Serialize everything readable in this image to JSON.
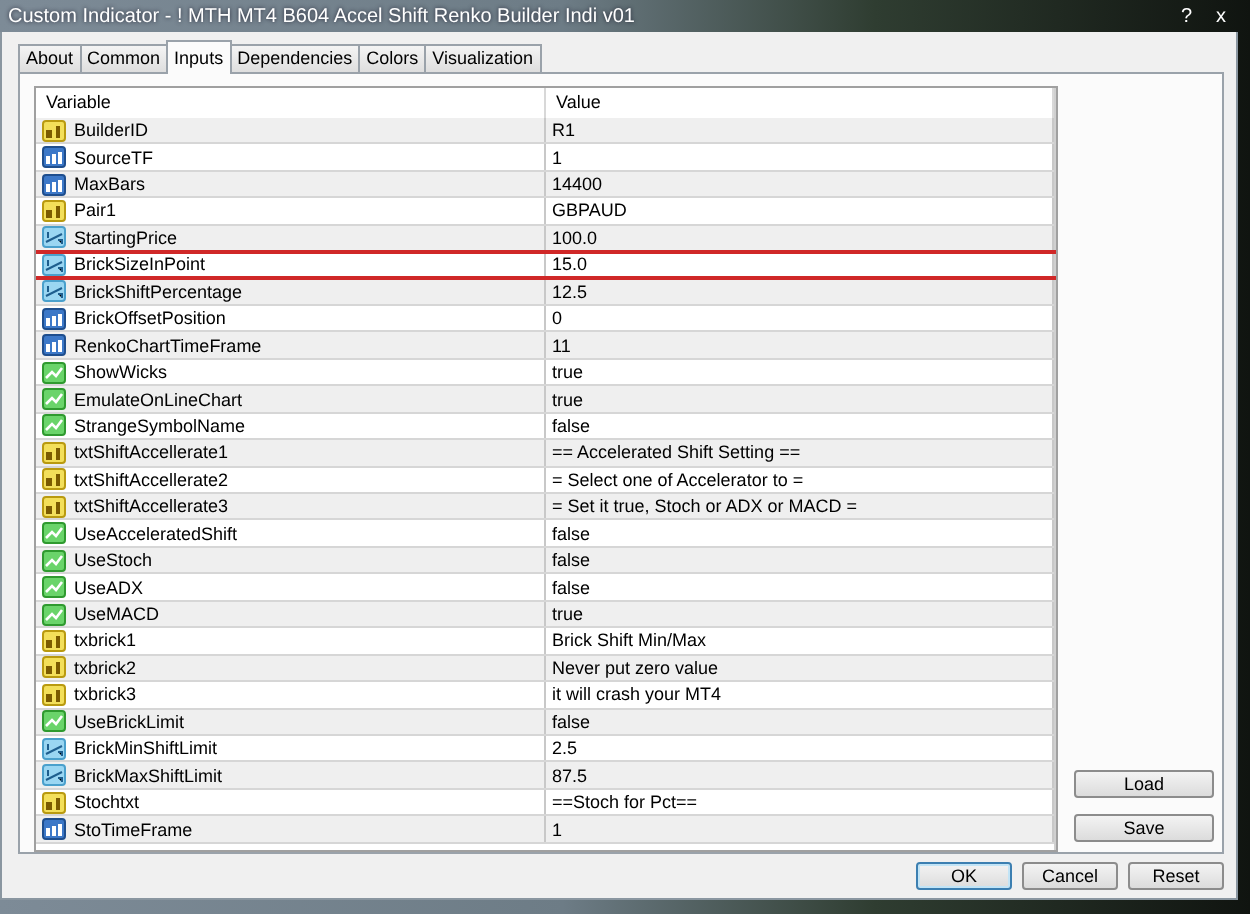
{
  "window": {
    "title": "Custom Indicator - !  MTH MT4 B604 Accel Shift Renko Builder Indi v01",
    "help": "?",
    "close": "x"
  },
  "tabs": [
    {
      "label": "About",
      "selected": false
    },
    {
      "label": "Common",
      "selected": false
    },
    {
      "label": "Inputs",
      "selected": true
    },
    {
      "label": "Dependencies",
      "selected": false
    },
    {
      "label": "Colors",
      "selected": false
    },
    {
      "label": "Visualization",
      "selected": false
    }
  ],
  "table": {
    "columns": [
      "Variable",
      "Value"
    ],
    "rows": [
      {
        "kind": "string",
        "variable": "BuilderID",
        "value": "R1",
        "highlighted": false
      },
      {
        "kind": "int",
        "variable": "SourceTF",
        "value": "1",
        "highlighted": false
      },
      {
        "kind": "int",
        "variable": "MaxBars",
        "value": "14400",
        "highlighted": false
      },
      {
        "kind": "string",
        "variable": "Pair1",
        "value": "GBPAUD",
        "highlighted": false
      },
      {
        "kind": "double",
        "variable": "StartingPrice",
        "value": "100.0",
        "highlighted": false
      },
      {
        "kind": "double",
        "variable": "BrickSizeInPoint",
        "value": "15.0",
        "highlighted": true
      },
      {
        "kind": "double",
        "variable": "BrickShiftPercentage",
        "value": "12.5",
        "highlighted": false
      },
      {
        "kind": "int",
        "variable": "BrickOffsetPosition",
        "value": "0",
        "highlighted": false
      },
      {
        "kind": "int",
        "variable": "RenkoChartTimeFrame",
        "value": "11",
        "highlighted": false
      },
      {
        "kind": "bool",
        "variable": "ShowWicks",
        "value": "true",
        "highlighted": false
      },
      {
        "kind": "bool",
        "variable": "EmulateOnLineChart",
        "value": "true",
        "highlighted": false
      },
      {
        "kind": "bool",
        "variable": "StrangeSymbolName",
        "value": "false",
        "highlighted": false
      },
      {
        "kind": "string",
        "variable": "txtShiftAccellerate1",
        "value": "== Accelerated Shift Setting  ==",
        "highlighted": false
      },
      {
        "kind": "string",
        "variable": "txtShiftAccellerate2",
        "value": "= Select one of Accelerator to =",
        "highlighted": false
      },
      {
        "kind": "string",
        "variable": "txtShiftAccellerate3",
        "value": "= Set it true, Stoch or ADX or MACD =",
        "highlighted": false
      },
      {
        "kind": "bool",
        "variable": "UseAcceleratedShift",
        "value": "false",
        "highlighted": false
      },
      {
        "kind": "bool",
        "variable": "UseStoch",
        "value": "false",
        "highlighted": false
      },
      {
        "kind": "bool",
        "variable": "UseADX",
        "value": "false",
        "highlighted": false
      },
      {
        "kind": "bool",
        "variable": "UseMACD",
        "value": "true",
        "highlighted": false
      },
      {
        "kind": "string",
        "variable": "txbrick1",
        "value": "Brick Shift Min/Max",
        "highlighted": false
      },
      {
        "kind": "string",
        "variable": "txbrick2",
        "value": "Never put zero value",
        "highlighted": false
      },
      {
        "kind": "string",
        "variable": "txbrick3",
        "value": "it will crash your MT4",
        "highlighted": false
      },
      {
        "kind": "bool",
        "variable": "UseBrickLimit",
        "value": "false",
        "highlighted": false
      },
      {
        "kind": "double",
        "variable": "BrickMinShiftLimit",
        "value": "2.5",
        "highlighted": false
      },
      {
        "kind": "double",
        "variable": "BrickMaxShiftLimit",
        "value": "87.5",
        "highlighted": false
      },
      {
        "kind": "string",
        "variable": "Stochtxt",
        "value": "==Stoch for Pct==",
        "highlighted": false
      },
      {
        "kind": "int",
        "variable": "StoTimeFrame",
        "value": "1",
        "highlighted": false
      }
    ]
  },
  "side_buttons": [
    "Load",
    "Save"
  ],
  "buttons": [
    "OK",
    "Cancel",
    "Reset"
  ]
}
